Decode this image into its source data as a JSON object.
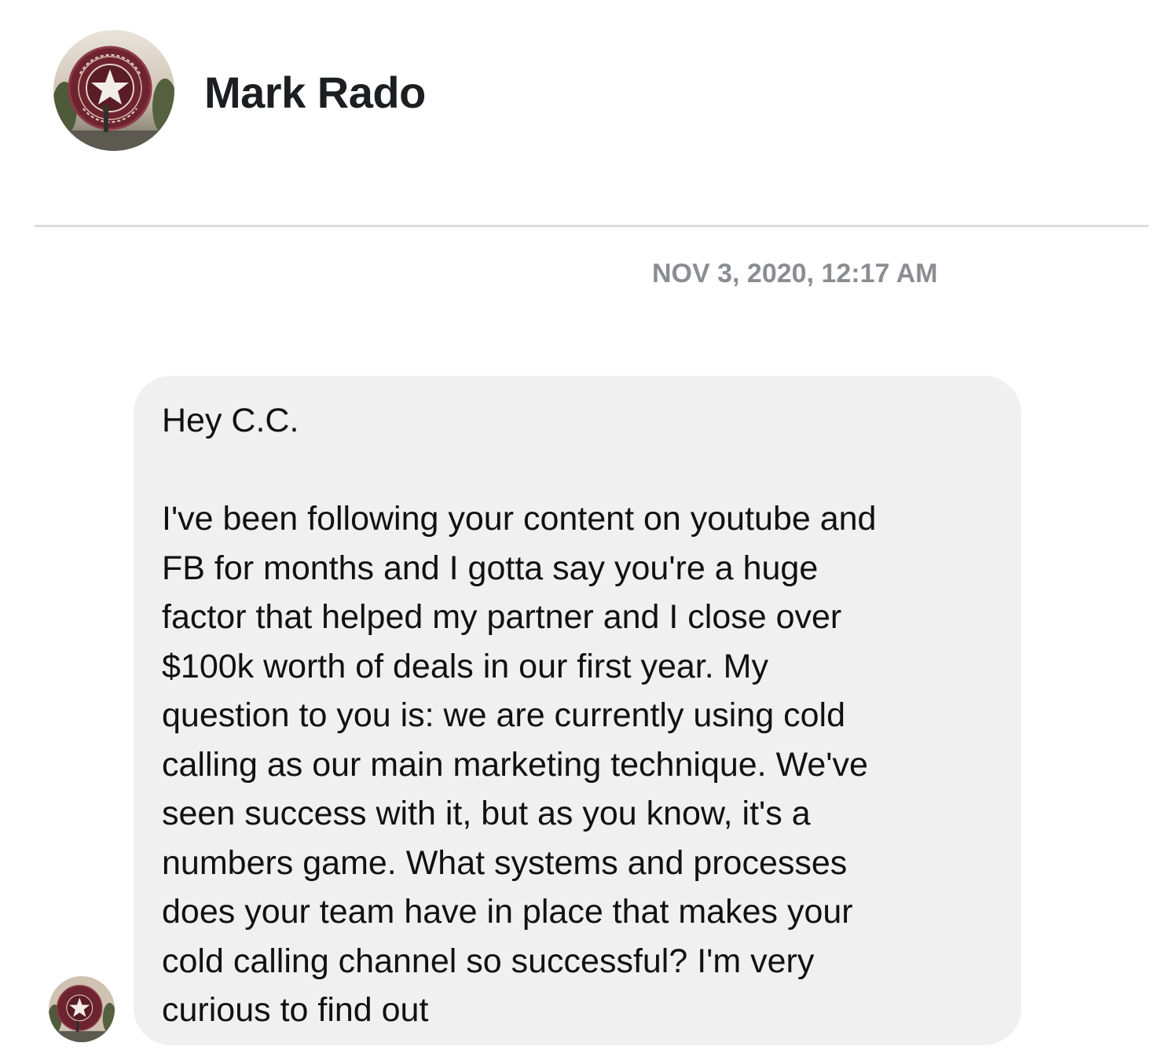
{
  "contact": {
    "name": "Mark Rado",
    "avatar_icon": "capitol-view-nashville-badge-avatar",
    "badge_text": "CAPITOL VIEW · NASHVILLE"
  },
  "conversation": {
    "timestamp": "NOV 3, 2020, 12:17 AM",
    "messages": [
      {
        "greeting": "Hey C.C.",
        "lines": [
          "I've been following your content on youtube and",
          "FB for months and I gotta say you're a huge",
          "factor that helped my partner and I close over",
          "$100k worth of deals in our first year. My",
          "question to you is: we are currently using cold",
          "calling as our main marketing technique. We've",
          "seen success with it, but as you know, it's a",
          "numbers game. What systems and processes",
          "does your team have in place that makes your",
          "cold calling channel so successful? I'm very",
          "curious to find out"
        ]
      }
    ]
  },
  "colors": {
    "bubble_background": "#f0f0f0",
    "timestamp_text": "#8a8d91",
    "divider": "#dcdcdc",
    "badge_maroon": "#6e2430"
  }
}
